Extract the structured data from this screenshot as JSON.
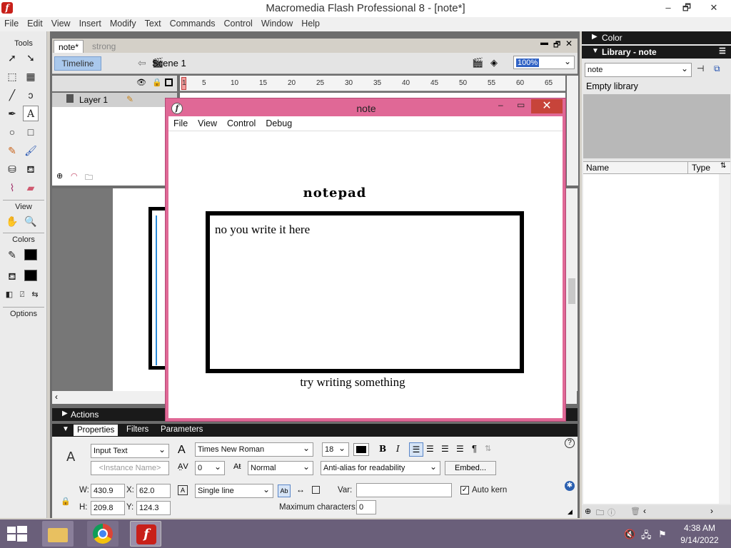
{
  "app": {
    "title": "Macromedia Flash Professional 8 - [note*]",
    "icon_letter": "f"
  },
  "window_controls": {
    "minimize": "–",
    "restore": "🗗",
    "close": "✕"
  },
  "menubar": [
    "File",
    "Edit",
    "View",
    "Insert",
    "Modify",
    "Text",
    "Commands",
    "Control",
    "Window",
    "Help"
  ],
  "tools": {
    "title": "Tools",
    "view_label": "View",
    "colors_label": "Colors",
    "options_label": "Options"
  },
  "doc_tabs": [
    "note*",
    "strong"
  ],
  "timeline": {
    "button": "Timeline",
    "scene": "Scene 1",
    "zoom": "100%",
    "layer": "Layer 1",
    "ruler": [
      "1",
      "5",
      "10",
      "15",
      "20",
      "25",
      "30",
      "35",
      "40",
      "45",
      "50",
      "55",
      "60",
      "65"
    ]
  },
  "panels": {
    "actions": "Actions",
    "properties_tab": "Properties",
    "filters_tab": "Filters",
    "parameters_tab": "Parameters"
  },
  "properties": {
    "text_type": "Input Text",
    "instance_name_placeholder": "<Instance Name>",
    "font": "Times New Roman",
    "size": "18",
    "letter_spacing": "0",
    "position": "Normal",
    "anti_alias": "Anti-alias for readability",
    "embed_button": "Embed...",
    "line_type": "Single line",
    "var_label": "Var:",
    "auto_kern": "Auto kern",
    "max_chars_label": "Maximum characters:",
    "max_chars": "0",
    "w_label": "W:",
    "w": "430.9",
    "h_label": "H:",
    "h": "209.8",
    "x_label": "X:",
    "x": "62.0",
    "y_label": "Y:",
    "y": "124.3"
  },
  "right_panel": {
    "color_header": "Color",
    "library_header": "Library - note",
    "library_select": "note",
    "empty_text": "Empty library",
    "col_name": "Name",
    "col_type": "Type"
  },
  "note_window": {
    "title": "note",
    "menu": [
      "File",
      "View",
      "Control",
      "Debug"
    ],
    "heading": "notepad",
    "textbox_value": "no you write it here",
    "footer": "try writing something"
  },
  "taskbar": {
    "time": "4:38 AM",
    "date": "9/14/2022"
  },
  "colors": {
    "note_frame": "#e06896",
    "taskbar": "#6a5f7a",
    "panel_header": "#1a1a1a"
  }
}
